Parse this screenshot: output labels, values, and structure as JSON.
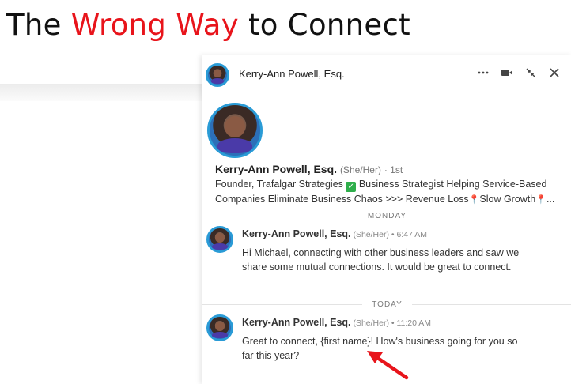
{
  "slide": {
    "title_pre": "The ",
    "title_accent": "Wrong Way",
    "title_post": " to Connect",
    "accent_color": "#e8141b"
  },
  "header": {
    "name": "Kerry-Ann Powell, Esq.",
    "icons": [
      "more-icon",
      "video-call-icon",
      "minimize-icon",
      "close-icon"
    ]
  },
  "profile": {
    "name": "Kerry-Ann Powell, Esq.",
    "pronouns": "(She/Her)",
    "degree": "· 1st",
    "headline_part1": "Founder, Trafalgar Strategies ",
    "headline_part2": " Business Strategist Helping Service-Based Companies Eliminate Business Chaos >>> Revenue Loss",
    "headline_part3": "Slow Growth",
    "headline_part4": "..."
  },
  "dividers": {
    "monday": "MONDAY",
    "today": "TODAY"
  },
  "messages": [
    {
      "sender": "Kerry-Ann Powell, Esq.",
      "meta": " (She/Her) • 6:47 AM",
      "body": "Hi Michael, connecting with other business leaders and saw we share some mutual connections. It would be great to connect."
    },
    {
      "sender": "Kerry-Ann Powell, Esq.",
      "meta": " (She/Her) • 11:20 AM",
      "body": "Great to connect, {first name}! How's business going for you so far this year?"
    }
  ],
  "colors": {
    "ring": "#2a9bd6",
    "arrow": "#e8141b"
  }
}
